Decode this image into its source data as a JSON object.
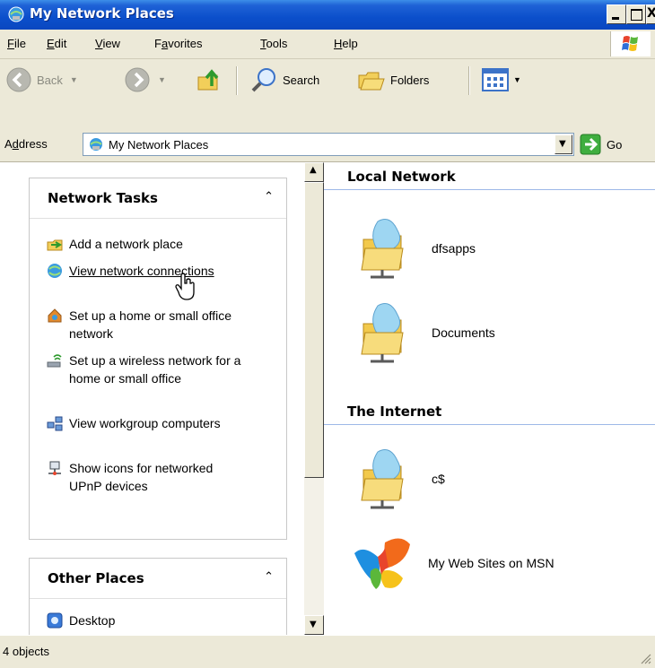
{
  "window": {
    "title": "My Network Places",
    "icon": "network-places-icon"
  },
  "menu": [
    {
      "label": "File",
      "accel": "F",
      "rest": "ile"
    },
    {
      "label": "Edit",
      "accel": "E",
      "rest": "dit"
    },
    {
      "label": "View",
      "accel": "V",
      "rest": "iew"
    },
    {
      "label": "Favorites",
      "pre": "F",
      "accel": "a",
      "rest": "vorites"
    },
    {
      "label": "Tools",
      "accel": "T",
      "rest": "ools"
    },
    {
      "label": "Help",
      "accel": "H",
      "rest": "elp"
    }
  ],
  "toolbar": {
    "back_label": "Back",
    "search_label": "Search",
    "folders_label": "Folders"
  },
  "address": {
    "label_pre": "A",
    "label_accel": "d",
    "label_rest": "dress",
    "value": "My Network Places",
    "go_label": "Go"
  },
  "network_tasks": {
    "title": "Network Tasks",
    "items": [
      {
        "label": "Add a network place",
        "icon": "add-network-place-icon"
      },
      {
        "label": "View network connections",
        "icon": "network-connections-icon"
      },
      {
        "label": "Set up a home or small office network",
        "icon": "home-network-icon"
      },
      {
        "label": "Set up a wireless network for a home or small office",
        "icon": "wireless-network-icon"
      },
      {
        "label": "View workgroup computers",
        "icon": "workgroup-computers-icon"
      },
      {
        "label": "Show icons for networked UPnP devices",
        "icon": "upnp-devices-icon"
      }
    ]
  },
  "other_places": {
    "title": "Other Places",
    "items": [
      {
        "label": "Desktop",
        "icon": "desktop-icon"
      }
    ]
  },
  "groups": {
    "local": {
      "title": "Local Network",
      "items": [
        {
          "label": "dfsapps",
          "icon": "network-folder-icon"
        },
        {
          "label": "Documents",
          "icon": "network-folder-icon"
        }
      ]
    },
    "internet": {
      "title": "The Internet",
      "items": [
        {
          "label": "c$",
          "icon": "network-folder-icon"
        },
        {
          "label": "My Web Sites on MSN",
          "icon": "msn-butterfly-icon"
        }
      ]
    }
  },
  "status": {
    "text": "4 objects"
  }
}
